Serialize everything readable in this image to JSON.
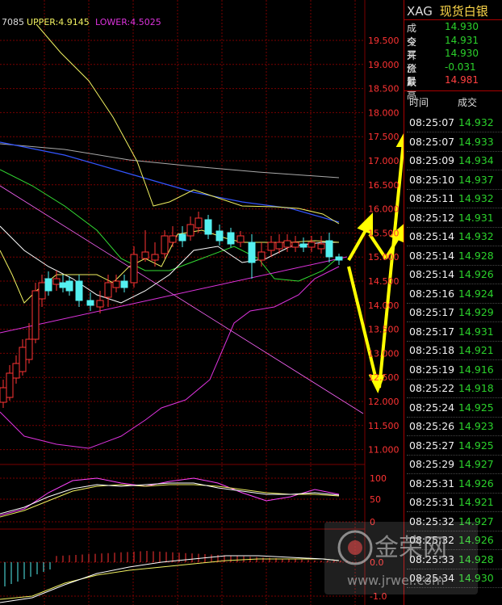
{
  "chart_header": {
    "fragment": "7085",
    "upper": "UPPER:4.9145",
    "lower": "LOWER:4.5025"
  },
  "price_axis": [
    "19.500",
    "19.000",
    "18.500",
    "18.000",
    "17.500",
    "17.000",
    "16.500",
    "16.000",
    "15.500",
    "15.000",
    "14.500",
    "14.000",
    "13.500",
    "13.000",
    "12.500",
    "12.000",
    "11.500",
    "11.000"
  ],
  "osc_axis": [
    "100",
    "50",
    "0"
  ],
  "macd_axis": [
    "0.0",
    "-1.0"
  ],
  "colors": {
    "up_candle": "#ff3333",
    "down_candle": "#54f0f0",
    "ma_yellow": "#f0f060",
    "ma_blue": "#3355ff",
    "ma_gray": "#aaaaaa",
    "ma_green": "#33dd33",
    "ma_magenta": "#dd33dd",
    "grid": "#7a0000",
    "axis_text": "#ff3333",
    "arrow": "#ffff00",
    "time_text": "#f2f2f2",
    "price_green": "#2bd12b",
    "price_red": "#ff4040"
  },
  "quote": {
    "symbol": "XAG",
    "name": "现货白银",
    "rows": [
      {
        "label": "成交",
        "value": "14.930",
        "color": "#2bd12b"
      },
      {
        "label": "今开",
        "value": "14.931",
        "color": "#2bd12b"
      },
      {
        "label": "买价1",
        "value": "14.930",
        "color": "#2bd12b"
      },
      {
        "label": "涨跌",
        "value": "-0.031",
        "color": "#2bd12b"
      },
      {
        "label": "最高",
        "value": "14.981",
        "color": "#ff4040"
      }
    ]
  },
  "ticks_header": {
    "time": "时间",
    "price": "成交"
  },
  "ticks": [
    {
      "time": "08:25:07",
      "price": "14.932"
    },
    {
      "time": "08:25:07",
      "price": "14.933"
    },
    {
      "time": "08:25:09",
      "price": "14.934"
    },
    {
      "time": "08:25:10",
      "price": "14.937"
    },
    {
      "time": "08:25:11",
      "price": "14.932"
    },
    {
      "time": "08:25:12",
      "price": "14.931"
    },
    {
      "time": "08:25:14",
      "price": "14.932"
    },
    {
      "time": "08:25:14",
      "price": "14.928"
    },
    {
      "time": "08:25:14",
      "price": "14.926"
    },
    {
      "time": "08:25:16",
      "price": "14.924"
    },
    {
      "time": "08:25:17",
      "price": "14.929"
    },
    {
      "time": "08:25:17",
      "price": "14.931"
    },
    {
      "time": "08:25:18",
      "price": "14.921"
    },
    {
      "time": "08:25:19",
      "price": "14.916"
    },
    {
      "time": "08:25:22",
      "price": "14.918"
    },
    {
      "time": "08:25:24",
      "price": "14.925"
    },
    {
      "time": "08:25:26",
      "price": "14.923"
    },
    {
      "time": "08:25:27",
      "price": "14.925"
    },
    {
      "time": "08:25:29",
      "price": "14.927"
    },
    {
      "time": "08:25:31",
      "price": "14.926"
    },
    {
      "time": "08:25:31",
      "price": "14.921"
    },
    {
      "time": "08:25:32",
      "price": "14.927"
    },
    {
      "time": "08:25:32",
      "price": "14.926"
    },
    {
      "time": "08:25:33",
      "price": "14.928"
    },
    {
      "time": "08:25:34",
      "price": "14.930"
    }
  ],
  "watermark": {
    "logo_text": "金荣网",
    "url": "www.jrwel.com"
  }
}
